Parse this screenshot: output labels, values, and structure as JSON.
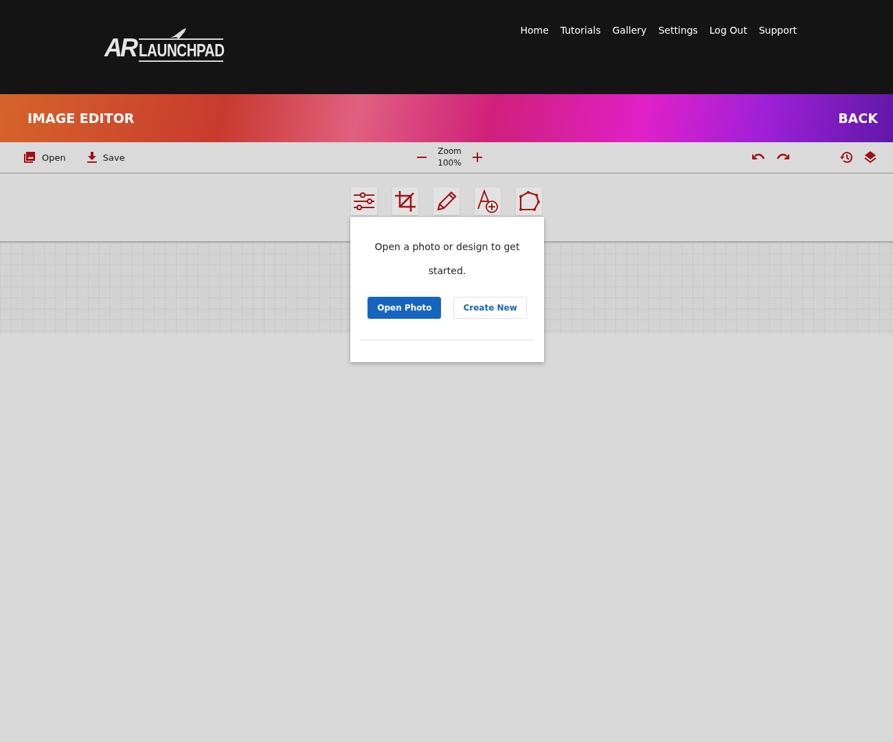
{
  "header": {
    "logo": {
      "mark": "AR",
      "name": "LAUNCHPAD"
    },
    "nav": [
      "Home",
      "Tutorials",
      "Gallery",
      "Settings",
      "Log Out",
      "Support"
    ]
  },
  "banner": {
    "title": "IMAGE EDITOR",
    "back": "BACK"
  },
  "toolbar": {
    "file_actions": [
      {
        "kind": "open",
        "label": "Open"
      },
      {
        "kind": "save",
        "label": "Save"
      }
    ],
    "zoom": {
      "label": "Zoom",
      "value": "100%"
    },
    "history_actions": [
      {
        "kind": "undo"
      },
      {
        "kind": "redo"
      },
      {
        "kind": "history"
      },
      {
        "kind": "layers"
      }
    ]
  },
  "tools": [
    {
      "kind": "adjust"
    },
    {
      "kind": "crop"
    },
    {
      "kind": "draw"
    },
    {
      "kind": "text"
    },
    {
      "kind": "shape"
    }
  ],
  "dialog": {
    "message": "Open a photo or design to get started.",
    "buttons": [
      {
        "kind": "primary",
        "label": "Open Photo"
      },
      {
        "kind": "secondary",
        "label": "Create New"
      }
    ]
  }
}
